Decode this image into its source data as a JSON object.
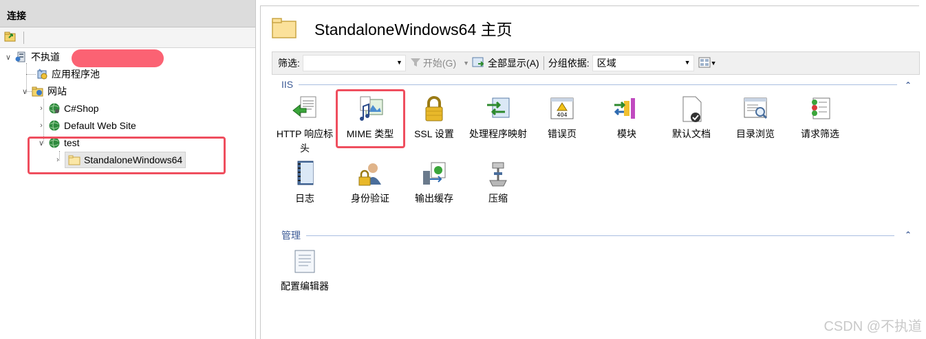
{
  "connections": {
    "header": "连接",
    "tree": {
      "server": "不执道",
      "app_pools": "应用程序池",
      "sites": "网站",
      "site_csharpshop": "C#Shop",
      "site_default": "Default Web Site",
      "site_test": "test",
      "app_standalone": "StandaloneWindows64"
    }
  },
  "main": {
    "title": "StandaloneWindows64 主页",
    "filter": {
      "label": "筛选:",
      "start_label": "开始(G)",
      "show_all_label": "全部显示(A)",
      "group_by_label": "分组依据:",
      "group_by_value": "区域"
    },
    "groups": [
      {
        "name": "IIS",
        "features": [
          {
            "label": "HTTP 响应标头",
            "icon": "http-response-headers-icon"
          },
          {
            "label": "MIME 类型",
            "icon": "mime-types-icon"
          },
          {
            "label": "SSL 设置",
            "icon": "ssl-lock-icon"
          },
          {
            "label": "处理程序映射",
            "icon": "handler-mappings-icon"
          },
          {
            "label": "错误页",
            "icon": "error-pages-icon"
          },
          {
            "label": "模块",
            "icon": "modules-icon"
          },
          {
            "label": "默认文档",
            "icon": "default-document-icon"
          },
          {
            "label": "目录浏览",
            "icon": "directory-browsing-icon"
          },
          {
            "label": "请求筛选",
            "icon": "request-filtering-icon"
          },
          {
            "label": "日志",
            "icon": "logging-icon"
          },
          {
            "label": "身份验证",
            "icon": "authentication-icon"
          },
          {
            "label": "输出缓存",
            "icon": "output-caching-icon"
          },
          {
            "label": "压缩",
            "icon": "compression-icon"
          }
        ]
      },
      {
        "name": "管理",
        "features": [
          {
            "label": "配置编辑器",
            "icon": "configuration-editor-icon"
          }
        ]
      }
    ]
  },
  "watermark": "CSDN @不执道",
  "colors": {
    "highlight": "#ef4e5e",
    "group_header": "#3c5a96",
    "redaction": "#fb5a6b"
  }
}
